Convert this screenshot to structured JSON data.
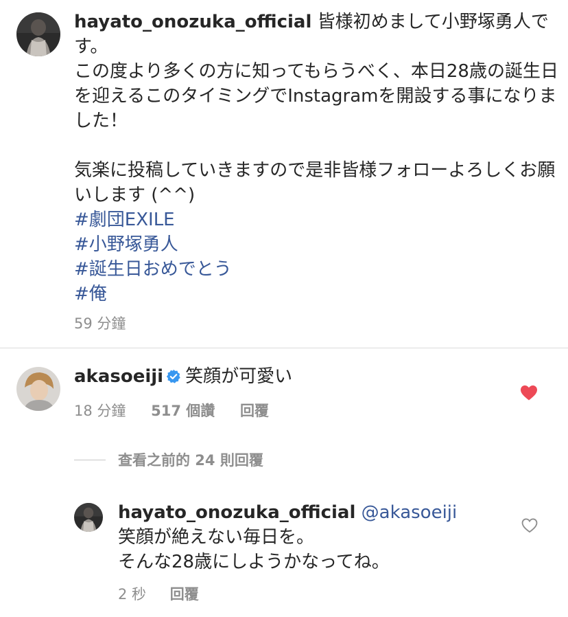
{
  "caption": {
    "username": "hayato_onozuka_official",
    "lines": [
      "皆様初めまして小野塚勇人です。",
      "この度より多くの方に知ってもらうべく、本日28歳の誕生日を迎えるこのタイミングでInstagramを開設する事になりました！",
      "気楽に投稿していきますので是非皆様フォローよろしくお願いします (^^)"
    ],
    "hashtags": [
      "#劇団EXILE",
      "#小野塚勇人",
      "#誕生日おめでとう",
      "#俺"
    ],
    "time": "59 分鐘"
  },
  "comment": {
    "username": "akasoeiji",
    "text": "笑顔が可愛い",
    "time": "18 分鐘",
    "likes": "517 個讚",
    "reply_label": "回覆",
    "liked": true,
    "heart_color": "#ed4956"
  },
  "view_replies": {
    "label": "查看之前的 24 則回覆"
  },
  "reply": {
    "username": "hayato_onozuka_official",
    "mention": "@akasoeiji",
    "lines": [
      "笑顔が絶えない毎日を。",
      "そんな28歳にしようかなってね。"
    ],
    "time": "2 秒",
    "reply_label": "回覆"
  },
  "colors": {
    "link": "#385898",
    "muted": "#8e8e8e",
    "verified": "#3897f0",
    "divider": "#dbdbdb"
  },
  "icons": {
    "verified": "verified-badge-icon",
    "like_filled": "heart-filled-icon",
    "like_outline": "heart-outline-icon"
  }
}
